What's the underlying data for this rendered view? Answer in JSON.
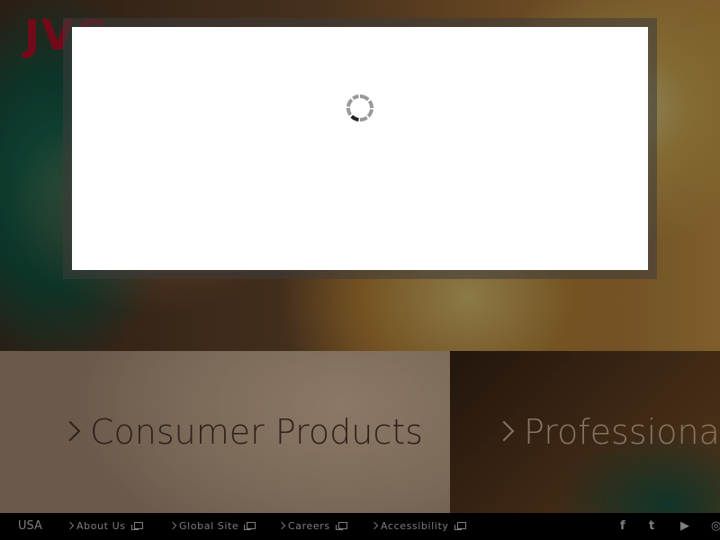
{
  "brand": {
    "logo_text": "JVC",
    "accent_color": "#c8102e"
  },
  "categories": [
    {
      "label": "Consumer Products"
    },
    {
      "label": "Professional"
    }
  ],
  "footer": {
    "region": "USA",
    "links": [
      {
        "label": "About Us",
        "icon": "external-link-icon"
      },
      {
        "label": "Global Site",
        "icon": "external-link-icon"
      },
      {
        "label": "Careers",
        "icon": "external-link-icon"
      },
      {
        "label": "Accessibility",
        "icon": "external-link-icon"
      }
    ],
    "social": [
      {
        "name": "facebook-icon",
        "glyph": "f"
      },
      {
        "name": "twitter-icon",
        "glyph": "t"
      },
      {
        "name": "youtube-icon",
        "glyph": "▶"
      },
      {
        "name": "instagram-icon",
        "glyph": "◎"
      }
    ]
  },
  "modal": {
    "state": "loading",
    "spinner": "loading-spinner-icon"
  }
}
